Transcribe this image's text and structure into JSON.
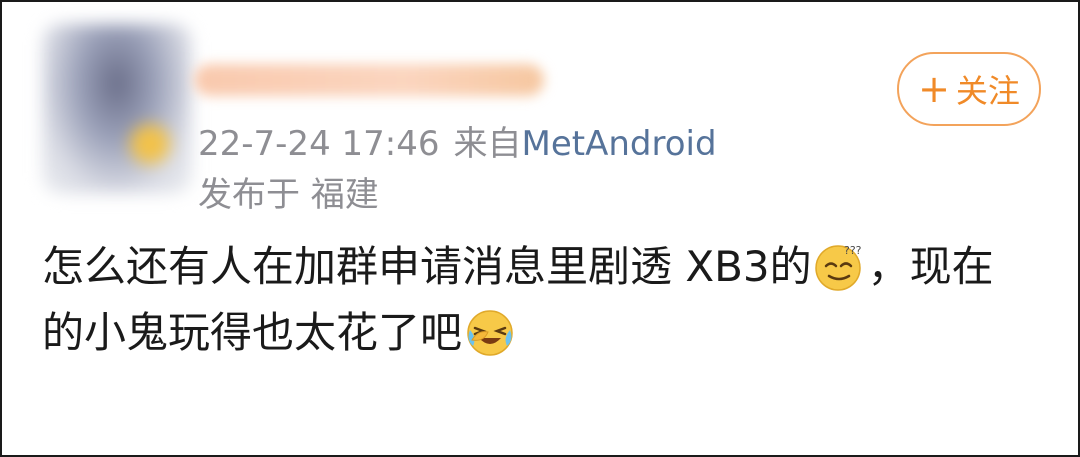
{
  "post": {
    "timestamp": "22-7-24 17:46",
    "source_label": "来自",
    "source_app": "MetAndroid",
    "location": "发布于 福建",
    "follow_label": "关注",
    "follow_plus": "+",
    "text_line1_a": "怎么还有人在加群申请消息里剧透 XB3的",
    "text_line1_b": "，现在",
    "text_line2": "的小鬼玩得也太花了吧",
    "emoji1_name": "sleepy-smirk-emoji-icon",
    "emoji2_name": "laughing-cry-emoji-icon"
  },
  "colors": {
    "meta_gray": "#8e8e93",
    "source_link": "#56739a",
    "follow_orange": "#f08a28",
    "text": "#1a1a1a"
  }
}
